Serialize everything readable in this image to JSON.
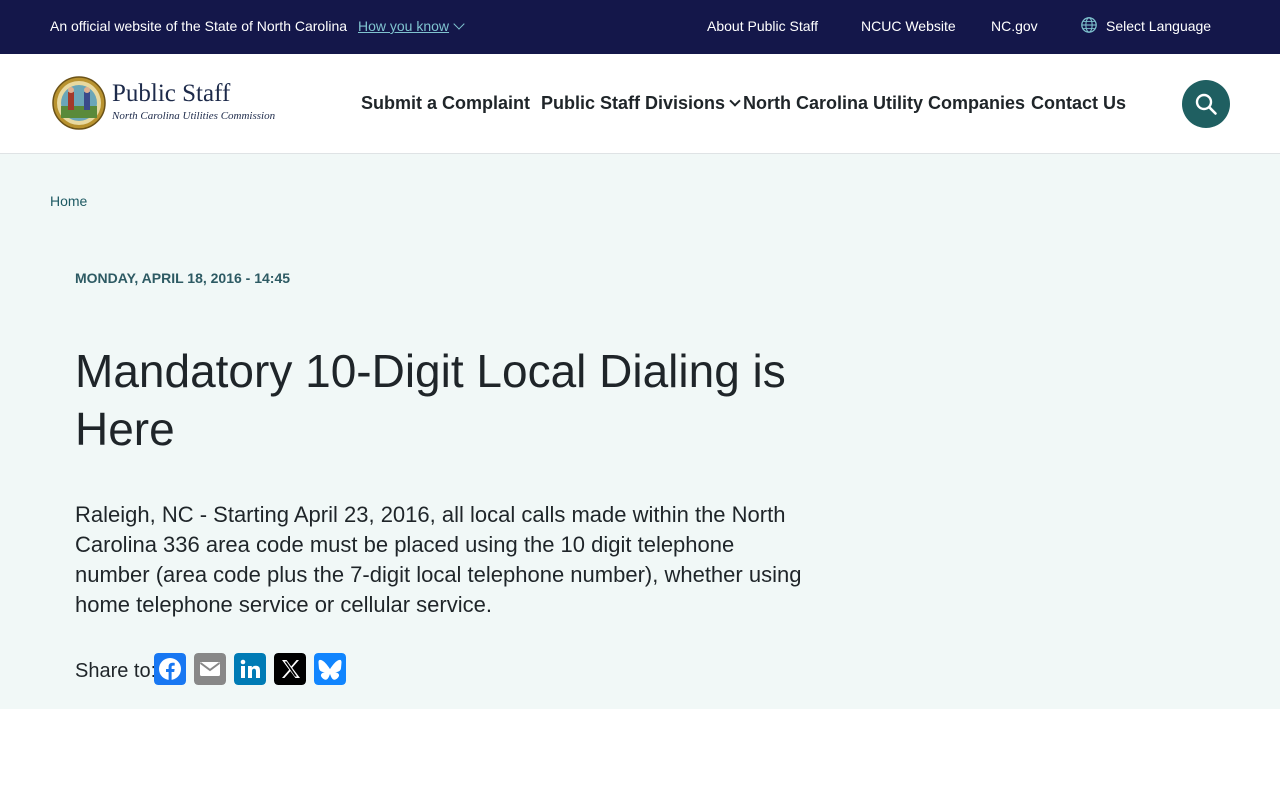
{
  "topbar": {
    "official_text": "An official website of the State of North Carolina",
    "how_you_know": "How you know",
    "links": [
      "About Public Staff",
      "NCUC Website",
      "NC.gov"
    ],
    "language": "Select Language"
  },
  "header": {
    "brand_title": "Public Staff",
    "brand_subtitle": "North Carolina Utilities Commission",
    "nav": [
      "Submit a Complaint",
      "Public Staff Divisions",
      "North Carolina Utility Companies",
      "Contact Us"
    ]
  },
  "breadcrumb": {
    "home": "Home"
  },
  "article": {
    "date": "MONDAY, APRIL 18, 2016 - 14:45",
    "title": "Mandatory 10-Digit Local Dialing is Here",
    "body": "Raleigh, NC - Starting April 23, 2016, all local calls made within the North Carolina 336 area code must be placed using the 10 digit telephone number (area code plus the 7-digit local telephone number), whether using home telephone service or cellular service.",
    "share_label": "Share to:"
  },
  "share_icons": [
    "facebook-icon",
    "email-icon",
    "linkedin-icon",
    "x-icon",
    "bluesky-icon"
  ],
  "colors": {
    "topbar_bg": "#14174a",
    "accent_teal": "#1f5f61",
    "main_bg": "#f1f8f7",
    "facebook": "#1877f2",
    "email": "#888888",
    "linkedin": "#007bb5",
    "x": "#000000",
    "bluesky": "#1185fe"
  }
}
